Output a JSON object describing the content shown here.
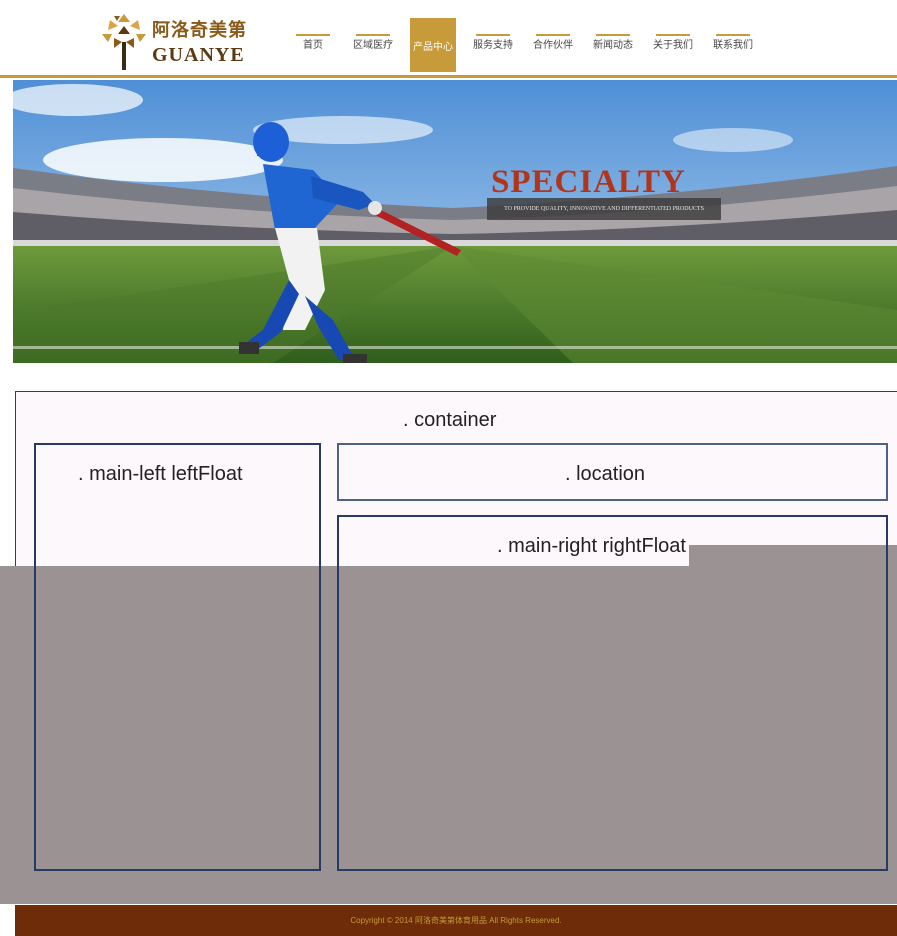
{
  "header": {
    "logo_cn": "阿洛奇美第",
    "logo_en": "GUANYE",
    "nav": [
      {
        "label": "首页",
        "active": false
      },
      {
        "label": "区域医疗",
        "active": false
      },
      {
        "label": "产品中心",
        "active": true
      },
      {
        "label": "服务支持",
        "active": false
      },
      {
        "label": "合作伙伴",
        "active": false
      },
      {
        "label": "新闻动态",
        "active": false
      },
      {
        "label": "关于我们",
        "active": false
      },
      {
        "label": "联系我们",
        "active": false
      }
    ]
  },
  "banner": {
    "headline": "SPECIALTY",
    "subline": "TO PROVIDE QUALITY, INNOVATIVE AND DIFFERENTIATED PRODUCTS"
  },
  "layout": {
    "container_label": ". container",
    "main_left_label": ". main-left leftFloat",
    "location_label": ". location",
    "main_right_label": ". main-right rightFloat"
  },
  "footer": {
    "copyright": "Copyright © 2014 阿洛奇美第体育用品 All Rights Reserved."
  },
  "colors": {
    "accent_gold": "#c79a3a",
    "footer_brown": "#6e2d08",
    "box_border": "#263a63",
    "overlay_gray": "#9b9294",
    "headline_red": "#b1351b"
  }
}
